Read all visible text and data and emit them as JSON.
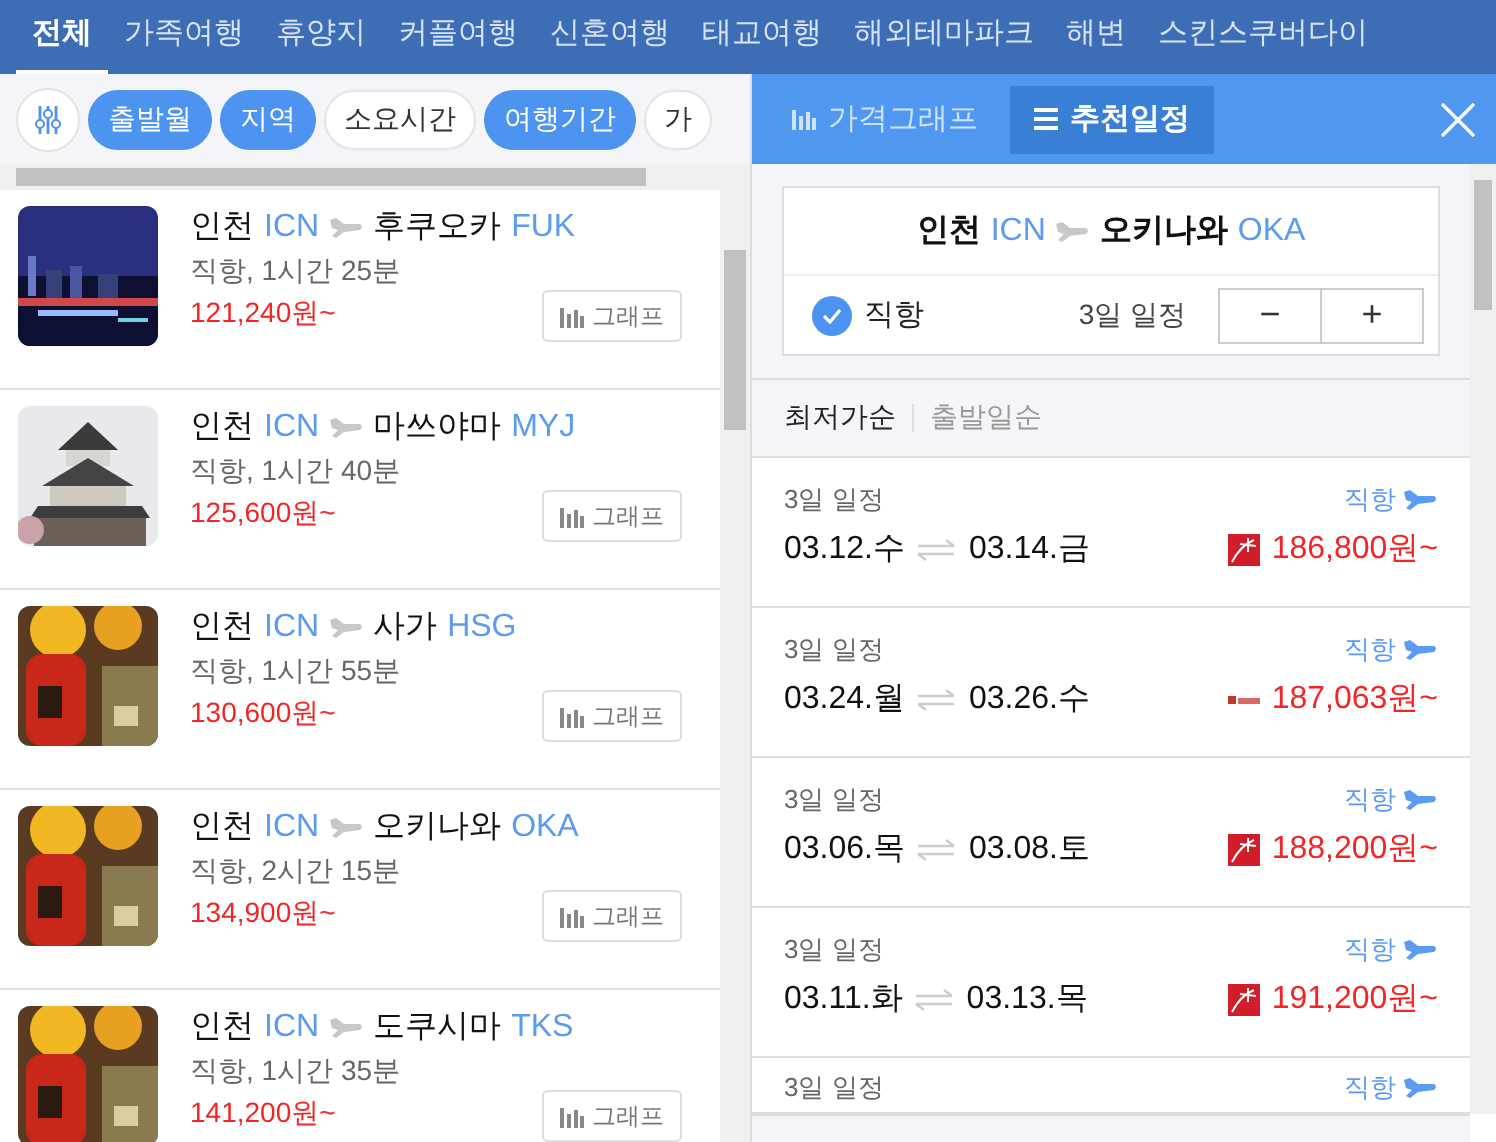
{
  "nav": {
    "tabs": [
      {
        "label": "전체",
        "selected": true
      },
      {
        "label": "가족여행",
        "selected": false
      },
      {
        "label": "휴양지",
        "selected": false
      },
      {
        "label": "커플여행",
        "selected": false
      },
      {
        "label": "신혼여행",
        "selected": false
      },
      {
        "label": "태교여행",
        "selected": false
      },
      {
        "label": "해외테마파크",
        "selected": false
      },
      {
        "label": "해변",
        "selected": false
      },
      {
        "label": "스킨스쿠버다이",
        "selected": false
      }
    ]
  },
  "filters": {
    "chips": [
      {
        "label": "출발월",
        "selected": true
      },
      {
        "label": "지역",
        "selected": true
      },
      {
        "label": "소요시간",
        "selected": false
      },
      {
        "label": "여행기간",
        "selected": true
      },
      {
        "label": "가",
        "selected": false
      }
    ]
  },
  "routes": [
    {
      "origin": "인천",
      "origin_code": "ICN",
      "destination": "후쿠오카",
      "destination_code": "FUK",
      "info": "직항, 1시간 25분",
      "price": "121,240원~",
      "button": "그래프"
    },
    {
      "origin": "인천",
      "origin_code": "ICN",
      "destination": "마쓰야마",
      "destination_code": "MYJ",
      "info": "직항, 1시간 40분",
      "price": "125,600원~",
      "button": "그래프"
    },
    {
      "origin": "인천",
      "origin_code": "ICN",
      "destination": "사가",
      "destination_code": "HSG",
      "info": "직항, 1시간 55분",
      "price": "130,600원~",
      "button": "그래프"
    },
    {
      "origin": "인천",
      "origin_code": "ICN",
      "destination": "오키나와",
      "destination_code": "OKA",
      "info": "직항, 2시간 15분",
      "price": "134,900원~",
      "button": "그래프"
    },
    {
      "origin": "인천",
      "origin_code": "ICN",
      "destination": "도쿠시마",
      "destination_code": "TKS",
      "info": "직항, 1시간 35분",
      "price": "141,200원~",
      "button": "그래프"
    }
  ],
  "panel": {
    "tabs": [
      {
        "label": "가격그래프",
        "selected": false
      },
      {
        "label": "추천일정",
        "selected": true
      }
    ],
    "route_card": {
      "origin": "인천",
      "origin_code": "ICN",
      "destination": "오키나와",
      "destination_code": "OKA",
      "direct": {
        "label": "직항",
        "checked": true
      },
      "duration": "3일 일정",
      "minus": "−",
      "plus": "+"
    },
    "sort": [
      {
        "label": "최저가순",
        "selected": true
      },
      {
        "label": "출발일순",
        "selected": false
      }
    ],
    "itineraries": [
      {
        "duration": "3일 일정",
        "type": "직항",
        "depart": "03.12.수",
        "return": "03.14.금",
        "price": "186,800원~",
        "kind": "square"
      },
      {
        "duration": "3일 일정",
        "type": "직항",
        "depart": "03.24.월",
        "return": "03.26.수",
        "price": "187,063원~",
        "kind": "mini"
      },
      {
        "duration": "3일 일정",
        "type": "직항",
        "depart": "03.06.목",
        "return": "03.08.토",
        "price": "188,200원~",
        "kind": "square"
      },
      {
        "duration": "3일 일정",
        "type": "직항",
        "depart": "03.11.화",
        "return": "03.13.목",
        "price": "191,200원~",
        "kind": "square"
      },
      {
        "duration": "3일 일정",
        "type": "직항"
      }
    ]
  }
}
